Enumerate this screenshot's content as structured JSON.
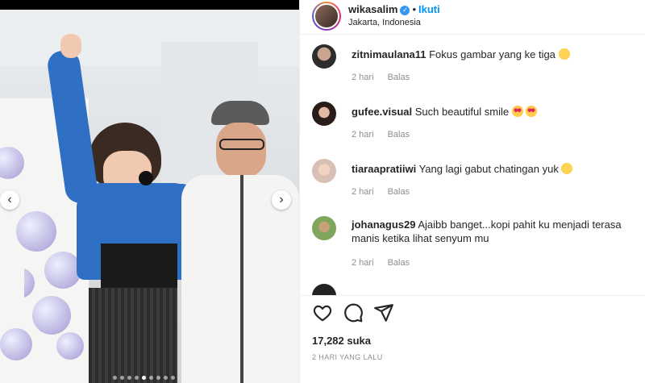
{
  "post": {
    "carousel_total": 9,
    "carousel_active": 4
  },
  "header": {
    "username": "wikasalim",
    "separator": "•",
    "follow_label": "Ikuti",
    "location": "Jakarta, Indonesia"
  },
  "comments": [
    {
      "user": "zitnimaulana11",
      "text": "Fokus gambar yang ke tiga",
      "emoji": "laughing-emoji",
      "time": "2 hari",
      "reply": "Balas"
    },
    {
      "user": "gufee.visual",
      "text": "Such beautiful smile",
      "emoji": "heart-eyes-emoji",
      "time": "2 hari",
      "reply": "Balas"
    },
    {
      "user": "tiaraapratiiwi",
      "text": "Yang lagi gabut chatingan yuk",
      "emoji": "grinning-emoji",
      "time": "2 hari",
      "reply": "Balas"
    },
    {
      "user": "johanagus29",
      "text": "Ajaibb banget...kopi pahit ku menjadi terasa manis ketika lihat senyum mu",
      "time": "2 hari",
      "reply": "Balas"
    }
  ],
  "footer": {
    "likes": "17,282 suka",
    "posted": "2 HARI YANG LALU"
  },
  "icons": {
    "like": "heart-icon",
    "comment": "comment-icon",
    "share": "send-icon",
    "prev": "chevron-left-icon",
    "next": "chevron-right-icon"
  },
  "colors": {
    "accent": "#0095f6",
    "verified": "#3897f0",
    "muted": "#8e8e8e"
  }
}
